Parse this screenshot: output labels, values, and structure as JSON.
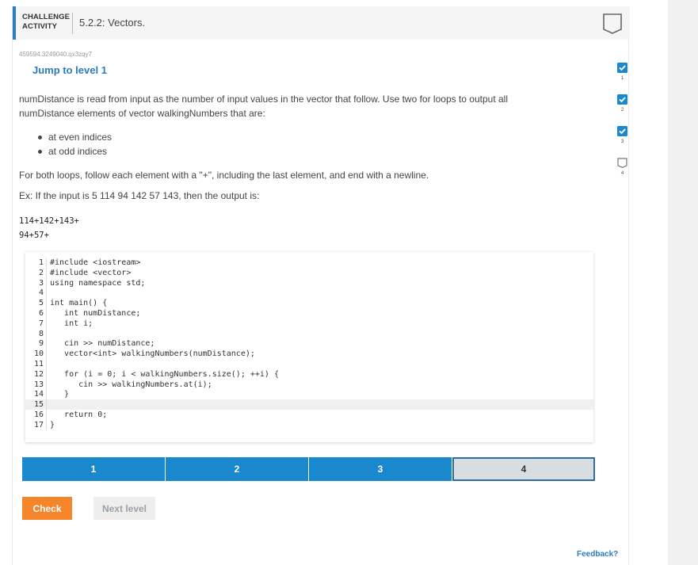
{
  "header": {
    "activity_label_line1": "CHALLENGE",
    "activity_label_line2": "ACTIVITY",
    "title": "5.2.2: Vectors.",
    "book_icon": "book-outline-icon"
  },
  "tracking_id": "459594.3249040.qx3zqy7",
  "jump_link": "Jump to level 1",
  "description": "numDistance is read from input as the number of input values in the vector that follow. Use two for loops to output all numDistance elements of vector walkingNumbers that are:",
  "bullets": [
    "at even indices",
    "at odd indices"
  ],
  "instruction": "For both loops, follow each element with a \"+\", including the last element, and end with a newline.",
  "example": "Ex: If the input is 5 114 94 142 57 143, then the output is:",
  "output_lines": [
    "114+142+143+",
    "94+57+"
  ],
  "code_lines": [
    {
      "n": "1",
      "text": "#include <iostream>"
    },
    {
      "n": "2",
      "text": "#include <vector>"
    },
    {
      "n": "3",
      "text": "using namespace std;"
    },
    {
      "n": "4",
      "text": ""
    },
    {
      "n": "5",
      "text": "int main() {"
    },
    {
      "n": "6",
      "text": "   int numDistance;"
    },
    {
      "n": "7",
      "text": "   int i;"
    },
    {
      "n": "8",
      "text": ""
    },
    {
      "n": "9",
      "text": "   cin >> numDistance;"
    },
    {
      "n": "10",
      "text": "   vector<int> walkingNumbers(numDistance);"
    },
    {
      "n": "11",
      "text": ""
    },
    {
      "n": "12",
      "text": "   for (i = 0; i < walkingNumbers.size(); ++i) {"
    },
    {
      "n": "13",
      "text": "      cin >> walkingNumbers.at(i);"
    },
    {
      "n": "14",
      "text": "   }"
    },
    {
      "n": "15",
      "text": ""
    },
    {
      "n": "16",
      "text": "   return 0;"
    },
    {
      "n": "17",
      "text": "}"
    }
  ],
  "highlighted_line": "15",
  "progress_segments": [
    {
      "label": "1",
      "state": "complete"
    },
    {
      "label": "2",
      "state": "complete"
    },
    {
      "label": "3",
      "state": "complete"
    },
    {
      "label": "4",
      "state": "current"
    }
  ],
  "buttons": {
    "check": "Check",
    "next": "Next level"
  },
  "feedback_link": "Feedback?",
  "level_checks": [
    {
      "num": "1",
      "done": true
    },
    {
      "num": "2",
      "done": true
    },
    {
      "num": "3",
      "done": true
    },
    {
      "num": "4",
      "done": false
    }
  ],
  "colors": {
    "accent_blue": "#1a88cc",
    "link_blue": "#2b7bbd",
    "check_orange": "#f4852b",
    "current_segment": "#d8dde2"
  }
}
